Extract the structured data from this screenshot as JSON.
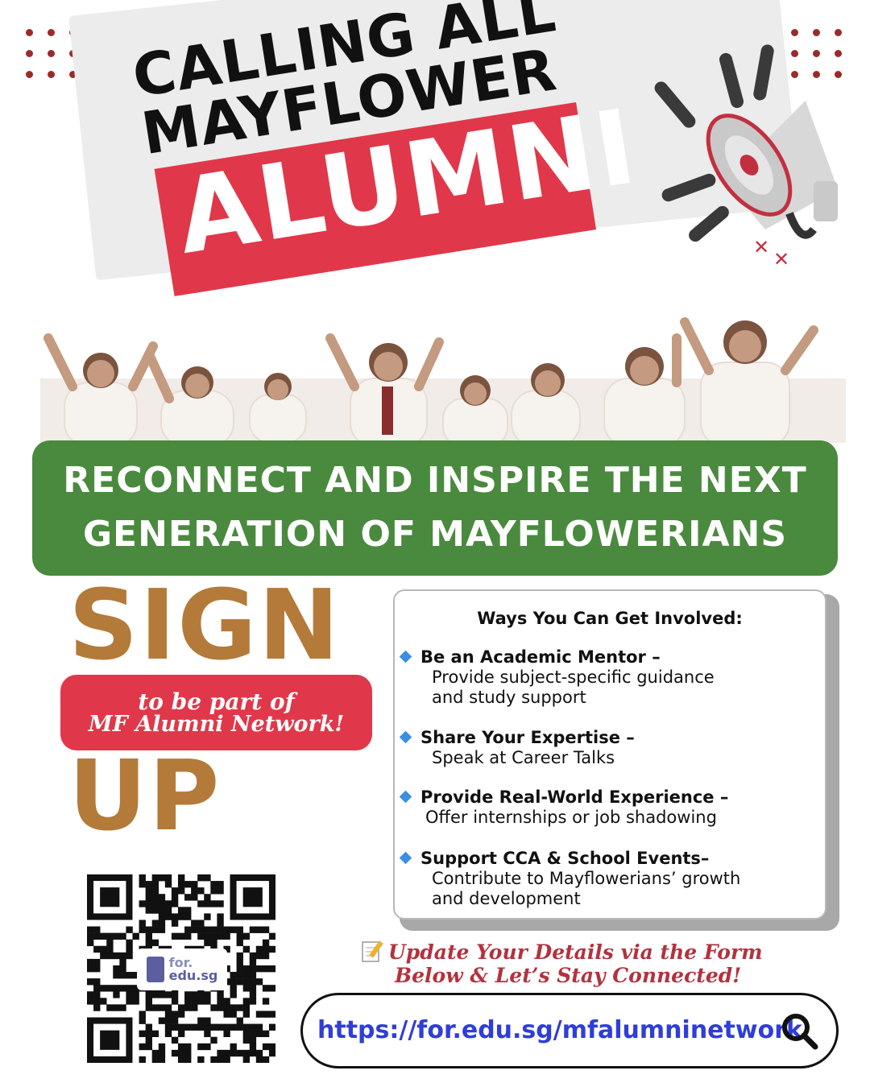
{
  "headline": {
    "line1": "CALLING ALL",
    "line2": "MAYFLOWER",
    "highlight": "ALUMNI"
  },
  "banner": {
    "line1": "RECONNECT AND INSPIRE THE NEXT",
    "line2": "GENERATION OF MAYFLOWERIANS"
  },
  "signup": {
    "word1": "SIGN",
    "word2": "UP",
    "pill_line1": "to be part of",
    "pill_line2": "MF Alumni Network!"
  },
  "ways": {
    "title": "Ways You Can Get Involved:",
    "items": [
      {
        "head": "Be an Academic Mentor –",
        "desc1": "Provide subject-specific guidance",
        "desc2": "and study support"
      },
      {
        "head": "Share Your Expertise –",
        "desc1": "Speak at Career Talks",
        "desc2": ""
      },
      {
        "head": "Provide Real-World Experience –",
        "desc1": "Offer internships or job shadowing",
        "desc2": ""
      },
      {
        "head": "Support CCA & School Events–",
        "desc1": "Contribute to Mayflowerians’ growth",
        "desc2": "and development"
      }
    ]
  },
  "qr": {
    "logo_line1": "for.",
    "logo_line2": "edu.sg"
  },
  "update": {
    "line1": "Update Your Details via the Form",
    "line2": "Below & Let’s Stay Connected!"
  },
  "link": {
    "url": "https://for.edu.sg/mfalumninetwork",
    "icon": "search-icon"
  },
  "colors": {
    "accent_red": "#e0384a",
    "green": "#4a8a3e",
    "brown": "#b47a3a",
    "dots": "#9b2b2b",
    "link_blue": "#2f3ed8"
  }
}
